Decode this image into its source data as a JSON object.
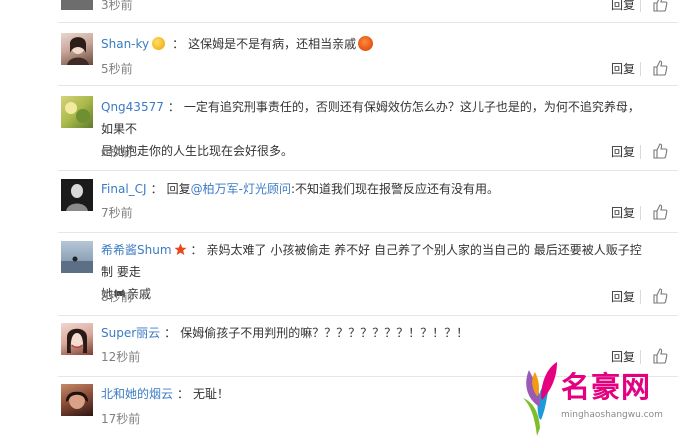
{
  "common": {
    "reply_label": "回复"
  },
  "partial_top": {
    "time": "3秒前"
  },
  "comments": [
    {
      "username": "Shan-ky",
      "colon": "：",
      "text": "这保姆是不是有病，还相当亲戚",
      "time": "5秒前",
      "emoji": "angry-face-emoji"
    },
    {
      "username": "Qng43577",
      "colon": "：",
      "text_line1": "一定有追究刑事责任的，否则还有保姆效仿怎么办？这儿子也是的，为何不追究养母，如果不",
      "text_line2": "是她抱走你的人生比现在会好很多。",
      "time": "6秒前"
    },
    {
      "username": "Final_CJ",
      "colon": "：",
      "reply_prefix": "回复",
      "mention": "@柏万军-灯光顾问",
      "text": ":不知道我们现在报警反应还有没有用。",
      "time": "7秒前"
    },
    {
      "username": "希希酱Shum",
      "colon": "：",
      "text_line1": "亲妈太难了 小孩被偷走 养不好 自己养了个别人家的当自己的 最后还要被人贩子控制 要走",
      "text_line2_a": "她",
      "text_line2_b": "亲戚",
      "time": "8秒前",
      "badge_icon": "star-badge-icon"
    },
    {
      "username": "Super丽云",
      "colon": "：",
      "text": "保姆偷孩子不用判刑的嘛？？？？？？？？！？！？！",
      "time": "12秒前"
    },
    {
      "username": "北和她的烟云",
      "colon": "：",
      "text": "无耻！",
      "time": "17秒前"
    }
  ],
  "watermark": {
    "title": "名豪网",
    "url": "minghaoshangwu.com"
  }
}
